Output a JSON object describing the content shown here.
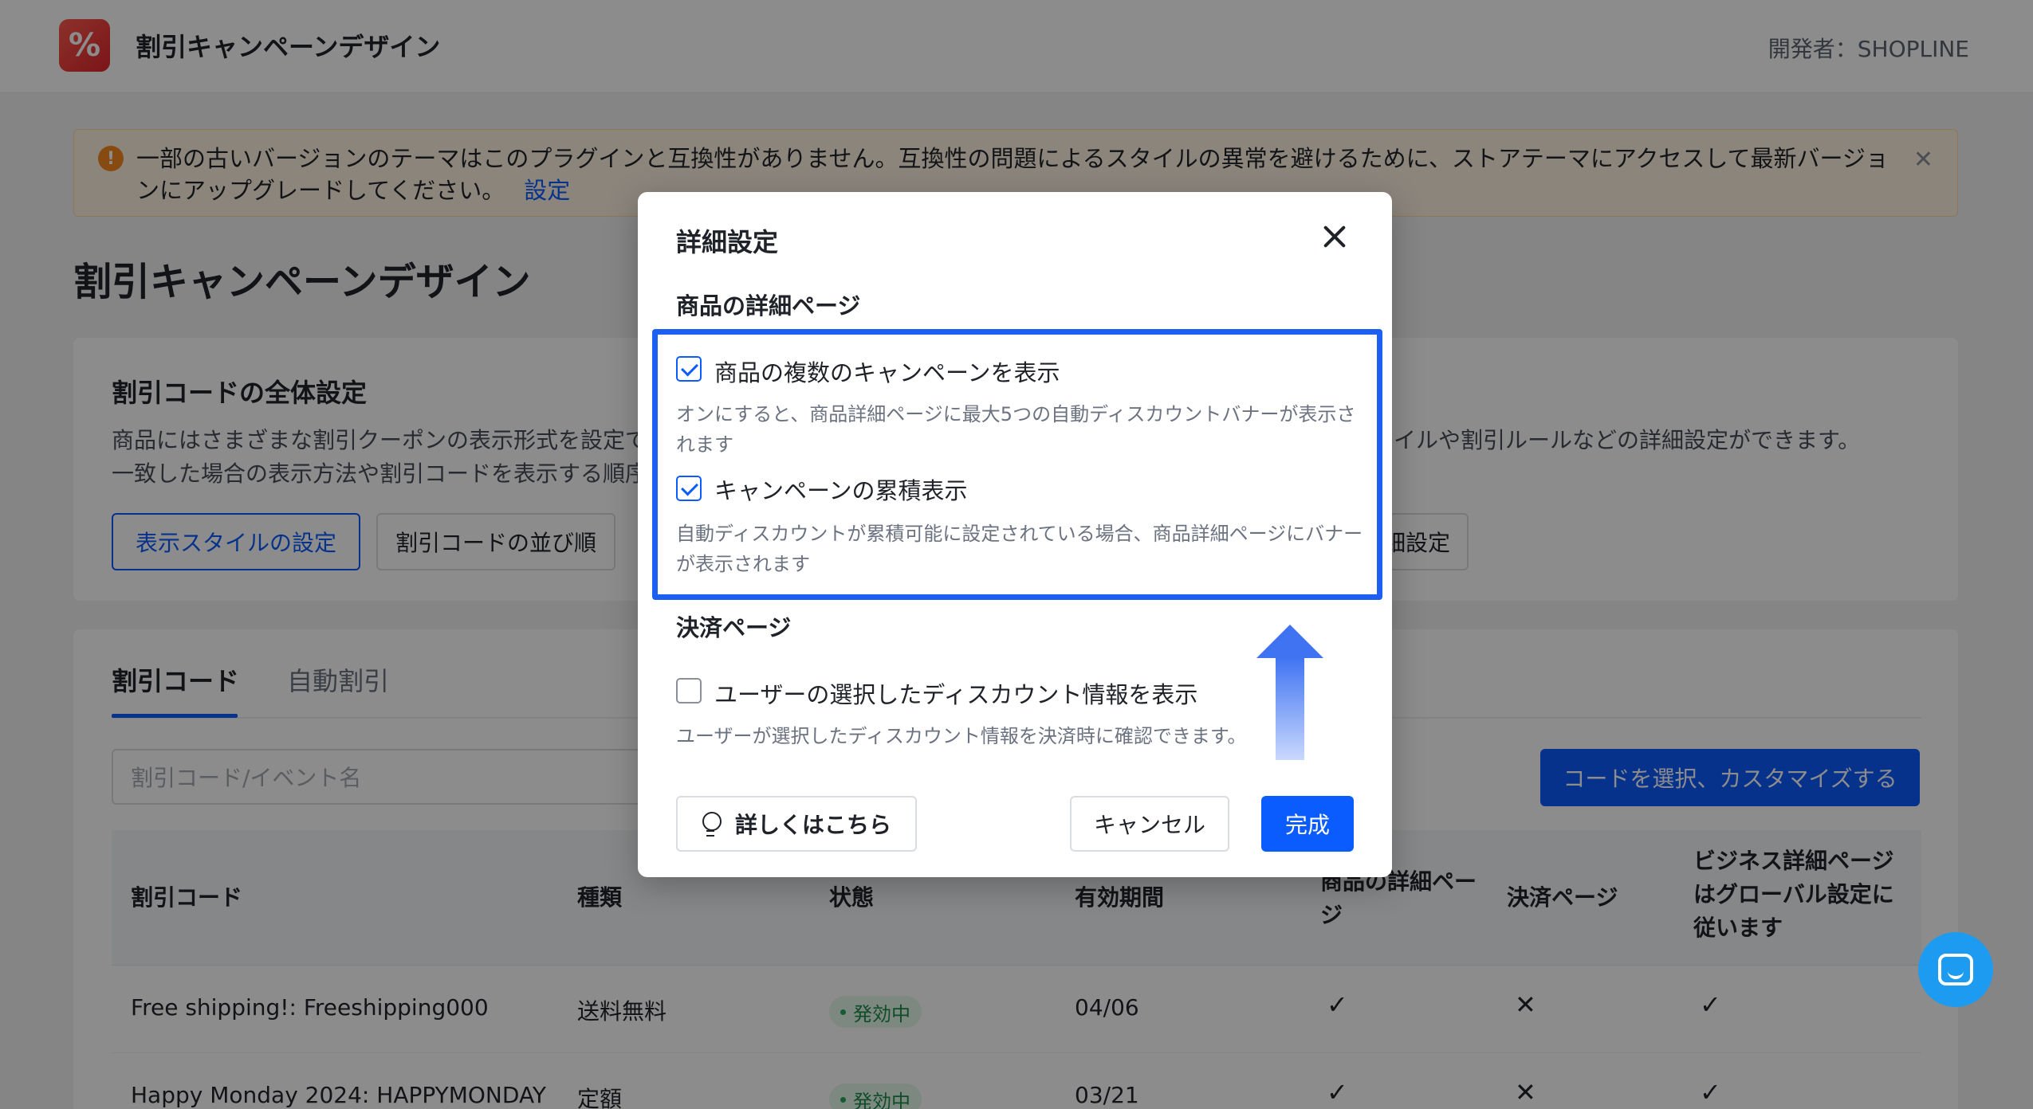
{
  "app": {
    "logo_glyph": "%",
    "title": "割引キャンペーンデザイン",
    "developer": "開発者：SHOPLINE"
  },
  "alert": {
    "text": "一部の古いバージョンのテーマはこのプラグインと互換性がありません。互換性の問題によるスタイルの異常を避けるために、ストアテーマにアクセスして最新バージョンにアップグレードしてください。",
    "link": "設定",
    "icon": "warning-icon",
    "close_icon": "close-icon"
  },
  "page": {
    "title": "割引キャンペーンデザイン"
  },
  "global_settings": {
    "title": "割引コードの全体設定",
    "desc_line1": "商品にはさまざまな割引クーポンの表示形式を設定で",
    "desc_line2": "一致した場合の表示方法や割引コードを表示する順序",
    "desc_right": "スタイルや割引ルールなどの詳細設定ができます。",
    "btn_display_style": "表示スタイルの設定",
    "btn_code_order": "割引コードの並び順",
    "btn_detail_fragment": "細設定"
  },
  "list": {
    "tabs": [
      "割引コード",
      "自動割引"
    ],
    "search_placeholder": "割引コード/イベント名",
    "btn_customize": "コードを選択、カスタマイズする",
    "columns": [
      "割引コード",
      "種類",
      "状態",
      "有効期間",
      "商品の詳細ページ",
      "決済ページ",
      "ビジネス詳細ページはグローバル設定に従います"
    ],
    "rows": [
      {
        "code": "Free shipping!: Freeshipping000",
        "type": "送料無料",
        "status": "発効中",
        "period": "04/06",
        "product_page": "✓",
        "checkout_page": "✕",
        "global": "✓"
      },
      {
        "code": "Happy Monday 2024: HAPPYMONDAY",
        "type": "定額",
        "status": "発効中",
        "period": "03/21",
        "product_page": "✓",
        "checkout_page": "✕",
        "global": "✓"
      }
    ]
  },
  "modal": {
    "title": "詳細設定",
    "product_section": "商品の詳細ページ",
    "option1_label": "商品の複数のキャンペーンを表示",
    "option1_checked": true,
    "option1_desc": "オンにすると、商品詳細ページに最大5つの自動ディスカウントバナーが表示されます",
    "option2_label": "キャンペーンの累積表示",
    "option2_checked": true,
    "option2_desc": "自動ディスカウントが累積可能に設定されている場合、商品詳細ページにバナーが表示されます",
    "checkout_section": "決済ページ",
    "option3_label": "ユーザーの選択したディスカウント情報を表示",
    "option3_checked": false,
    "option3_desc": "ユーザーが選択したディスカウント情報を決済時に確認できます。",
    "btn_learn_more": "詳しくはこちら",
    "btn_cancel": "キャンセル",
    "btn_done": "完成"
  },
  "colors": {
    "primary": "#0b5cff",
    "highlight": "#1d5ff0",
    "status_green": "#1d8b47",
    "alert_bg": "#fff3e2"
  }
}
